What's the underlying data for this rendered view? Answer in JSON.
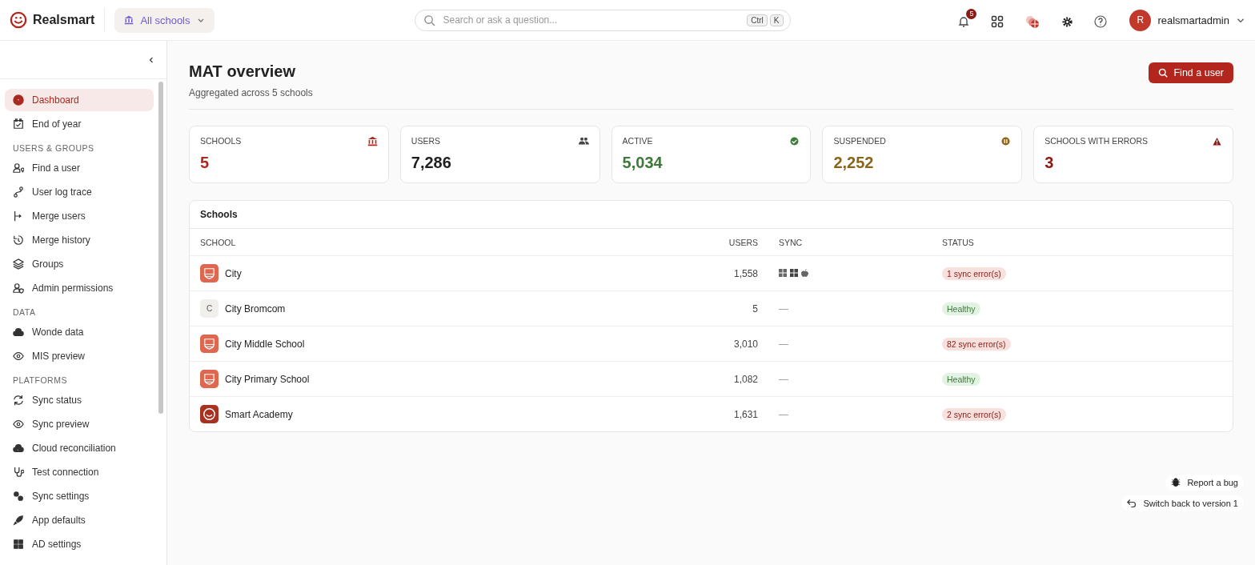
{
  "brand": {
    "name": "Realsmart"
  },
  "school_picker": {
    "label": "All schools"
  },
  "search": {
    "placeholder": "Search or ask a question...",
    "keys": [
      "Ctrl",
      "K"
    ]
  },
  "notifications": {
    "count": "5"
  },
  "user": {
    "initial": "R",
    "name": "realsmartadmin"
  },
  "sidebar": {
    "sections": [
      {
        "items": [
          {
            "label": "Dashboard",
            "selected": true
          },
          {
            "label": "End of year",
            "selected": false
          }
        ]
      },
      {
        "title": "USERS & GROUPS",
        "items": [
          {
            "label": "Find a user",
            "selected": false
          },
          {
            "label": "User log trace",
            "selected": false
          },
          {
            "label": "Merge users",
            "selected": false
          },
          {
            "label": "Merge history",
            "selected": false
          },
          {
            "label": "Groups",
            "selected": false
          },
          {
            "label": "Admin permissions",
            "selected": false
          }
        ]
      },
      {
        "title": "DATA",
        "items": [
          {
            "label": "Wonde data",
            "selected": false
          },
          {
            "label": "MIS preview",
            "selected": false
          }
        ]
      },
      {
        "title": "PLATFORMS",
        "items": [
          {
            "label": "Sync status",
            "selected": false
          },
          {
            "label": "Sync preview",
            "selected": false
          },
          {
            "label": "Cloud reconciliation",
            "selected": false
          },
          {
            "label": "Test connection",
            "selected": false
          },
          {
            "label": "Sync settings",
            "selected": false
          },
          {
            "label": "App defaults",
            "selected": false
          },
          {
            "label": "AD settings",
            "selected": false
          }
        ]
      }
    ]
  },
  "page": {
    "title": "MAT overview",
    "subtitle": "Aggregated across 5 schools",
    "action": "Find a user"
  },
  "stats": [
    {
      "label": "SCHOOLS",
      "value": "5",
      "color": "#b3261e"
    },
    {
      "label": "USERS",
      "value": "7,286",
      "color": "#1f1f1f"
    },
    {
      "label": "ACTIVE",
      "value": "5,034",
      "color": "#3d7a3a"
    },
    {
      "label": "SUSPENDED",
      "value": "2,252",
      "color": "#8a6418"
    },
    {
      "label": "SCHOOLS WITH ERRORS",
      "value": "3",
      "color": "#8b1a14"
    }
  ],
  "table": {
    "title": "Schools",
    "columns": [
      "SCHOOL",
      "USERS",
      "SYNC",
      "STATUS"
    ],
    "rows": [
      {
        "logo": {
          "kind": "crest"
        },
        "name": "City",
        "users": "1,558",
        "sync": {
          "kind": "icons"
        },
        "status": {
          "kind": "error",
          "text": "1 sync error(s)"
        }
      },
      {
        "logo": {
          "kind": "letter",
          "text": "C"
        },
        "name": "City Bromcom",
        "users": "5",
        "sync": {
          "kind": "text",
          "text": "—"
        },
        "status": {
          "kind": "healthy",
          "text": "Healthy"
        }
      },
      {
        "logo": {
          "kind": "crest"
        },
        "name": "City Middle School",
        "users": "3,010",
        "sync": {
          "kind": "text",
          "text": "—"
        },
        "status": {
          "kind": "error",
          "text": "82 sync error(s)"
        }
      },
      {
        "logo": {
          "kind": "crest"
        },
        "name": "City Primary School",
        "users": "1,082",
        "sync": {
          "kind": "text",
          "text": "—"
        },
        "status": {
          "kind": "healthy",
          "text": "Healthy"
        }
      },
      {
        "logo": {
          "kind": "smile"
        },
        "name": "Smart Academy",
        "users": "1,631",
        "sync": {
          "kind": "text",
          "text": "—"
        },
        "status": {
          "kind": "error",
          "text": "2 sync error(s)"
        }
      }
    ]
  },
  "floating": {
    "report": "Report a bug",
    "switch": "Switch back to version 1"
  }
}
